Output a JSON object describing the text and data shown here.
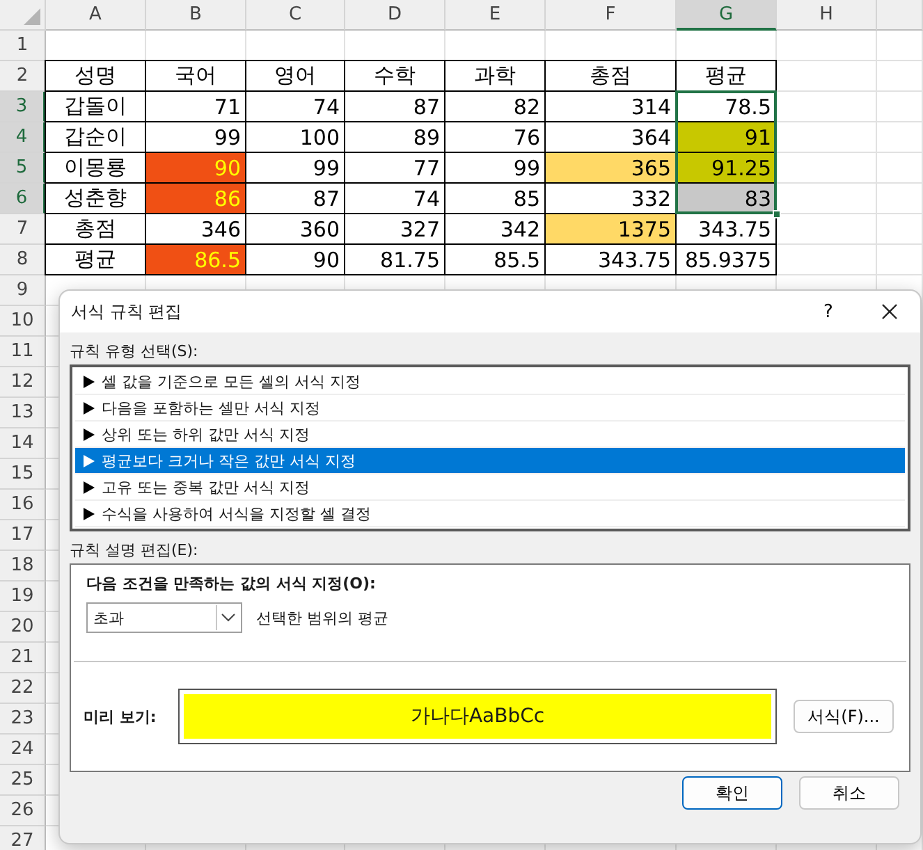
{
  "sheet": {
    "column_headers": [
      {
        "label": "A",
        "selected": false
      },
      {
        "label": "B",
        "selected": false
      },
      {
        "label": "C",
        "selected": false
      },
      {
        "label": "D",
        "selected": false
      },
      {
        "label": "E",
        "selected": false
      },
      {
        "label": "F",
        "selected": false
      },
      {
        "label": "G",
        "selected": true
      },
      {
        "label": "H",
        "selected": false
      }
    ],
    "row_headers": [
      {
        "label": "1",
        "selected": false
      },
      {
        "label": "2",
        "selected": false
      },
      {
        "label": "3",
        "selected": true
      },
      {
        "label": "4",
        "selected": true
      },
      {
        "label": "5",
        "selected": true
      },
      {
        "label": "6",
        "selected": true
      },
      {
        "label": "7",
        "selected": false
      },
      {
        "label": "8",
        "selected": false
      },
      {
        "label": "9",
        "selected": false
      },
      {
        "label": "10",
        "selected": false
      },
      {
        "label": "11",
        "selected": false
      },
      {
        "label": "12",
        "selected": false
      },
      {
        "label": "13",
        "selected": false
      },
      {
        "label": "14",
        "selected": false
      },
      {
        "label": "15",
        "selected": false
      },
      {
        "label": "16",
        "selected": false
      },
      {
        "label": "17",
        "selected": false
      },
      {
        "label": "18",
        "selected": false
      },
      {
        "label": "19",
        "selected": false
      },
      {
        "label": "20",
        "selected": false
      },
      {
        "label": "21",
        "selected": false
      },
      {
        "label": "22",
        "selected": false
      },
      {
        "label": "23",
        "selected": false
      },
      {
        "label": "24",
        "selected": false
      },
      {
        "label": "25",
        "selected": false
      },
      {
        "label": "26",
        "selected": false
      },
      {
        "label": "27",
        "selected": false
      }
    ],
    "rows": [
      [
        {
          "text": "성명"
        },
        {
          "text": "국어"
        },
        {
          "text": "영어"
        },
        {
          "text": "수학"
        },
        {
          "text": "과학"
        },
        {
          "text": "총점"
        },
        {
          "text": "평균"
        }
      ],
      [
        {
          "text": "갑돌이"
        },
        {
          "text": "71"
        },
        {
          "text": "74"
        },
        {
          "text": "87"
        },
        {
          "text": "82"
        },
        {
          "text": "314"
        },
        {
          "text": "78.5"
        }
      ],
      [
        {
          "text": "갑순이"
        },
        {
          "text": "99"
        },
        {
          "text": "100"
        },
        {
          "text": "89"
        },
        {
          "text": "76"
        },
        {
          "text": "364"
        },
        {
          "text": "91",
          "color": "#c8c800"
        }
      ],
      [
        {
          "text": "이몽룡"
        },
        {
          "text": "90",
          "color": "#f05014",
          "emphasis": true
        },
        {
          "text": "99"
        },
        {
          "text": "77"
        },
        {
          "text": "99"
        },
        {
          "text": "365",
          "color": "#ffd966"
        },
        {
          "text": "91.25",
          "color": "#c8c800"
        }
      ],
      [
        {
          "text": "성춘향"
        },
        {
          "text": "86",
          "color": "#f05014",
          "emphasis": true
        },
        {
          "text": "87"
        },
        {
          "text": "74"
        },
        {
          "text": "85"
        },
        {
          "text": "332"
        },
        {
          "text": "83",
          "color": "#c8c8c8"
        }
      ],
      [
        {
          "text": "총점"
        },
        {
          "text": "346"
        },
        {
          "text": "360"
        },
        {
          "text": "327"
        },
        {
          "text": "342"
        },
        {
          "text": "1375",
          "color": "#ffd966"
        },
        {
          "text": "343.75"
        }
      ],
      [
        {
          "text": "평균"
        },
        {
          "text": "86.5",
          "color": "#f05014",
          "emphasis": true
        },
        {
          "text": "90"
        },
        {
          "text": "81.75"
        },
        {
          "text": "85.5"
        },
        {
          "text": "343.75"
        },
        {
          "text": "85.9375"
        }
      ]
    ]
  },
  "dialog": {
    "title": "서식 규칙 편집",
    "help": "?",
    "rule_type_label": "규칙 유형 선택(S):",
    "rule_types": [
      {
        "label": "셀 값을 기준으로 모든 셀의 서식 지정",
        "selected": false
      },
      {
        "label": "다음을 포함하는 셀만 서식 지정",
        "selected": false
      },
      {
        "label": "상위 또는 하위 값만 서식 지정",
        "selected": false
      },
      {
        "label": "평균보다 크거나 작은 값만 서식 지정",
        "selected": true
      },
      {
        "label": "고유 또는 중복 값만 서식 지정",
        "selected": false
      },
      {
        "label": "수식을 사용하여 서식을 지정할 셀 결정",
        "selected": false
      }
    ],
    "description_label": "규칙 설명 편집(E):",
    "condition_label": "다음 조건을 만족하는 값의 서식 지정(O):",
    "operator": {
      "value": "초과"
    },
    "operator_suffix": "선택한 범위의 평균",
    "preview_label": "미리 보기:",
    "preview": {
      "text": "가나다AaBbCc",
      "color": "#ffff00"
    },
    "format_button": "서식(F)...",
    "ok_button": "확인",
    "cancel_button": "취소"
  }
}
